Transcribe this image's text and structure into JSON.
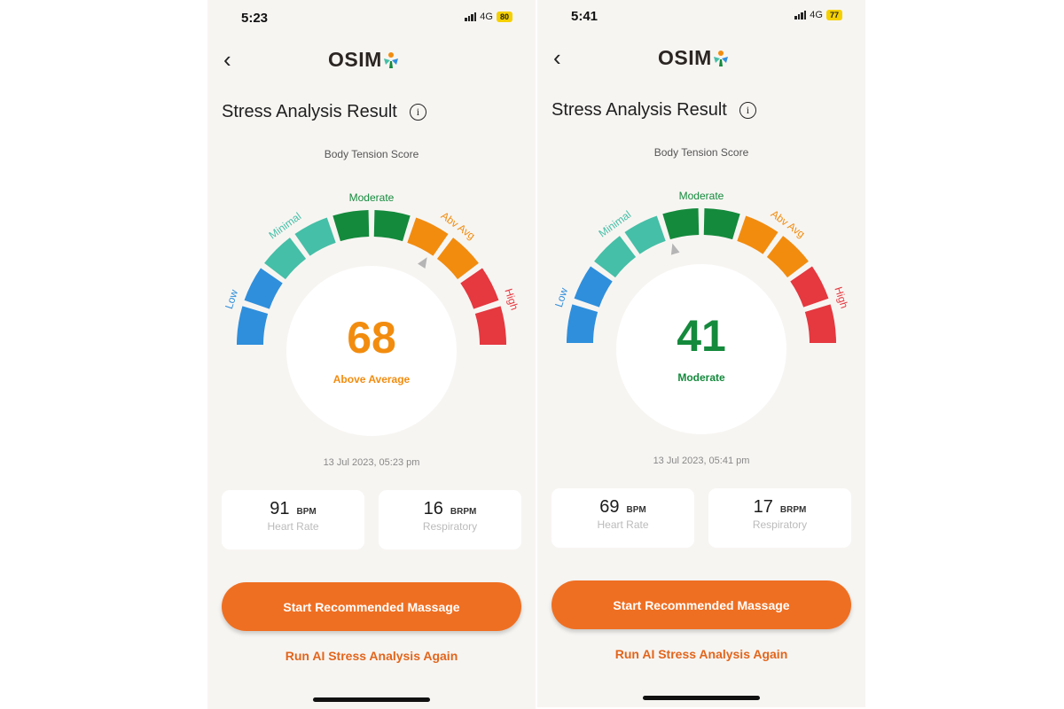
{
  "colors": {
    "low": "#2f8fdc",
    "minimal": "#45bfa7",
    "moderate": "#148a3c",
    "abv_avg": "#f28c0f",
    "high": "#e5383f",
    "button": "#ef6f22",
    "link": "#e2651c"
  },
  "gauge": {
    "range": [
      0,
      100
    ],
    "segments": [
      "low",
      "low",
      "minimal",
      "minimal",
      "moderate",
      "moderate",
      "abv_avg",
      "abv_avg",
      "high",
      "high"
    ],
    "labels": [
      {
        "key": "low",
        "text": "Low"
      },
      {
        "key": "minimal",
        "text": "Minimal"
      },
      {
        "key": "moderate",
        "text": "Moderate"
      },
      {
        "key": "abv_avg",
        "text": "Abv Avg"
      },
      {
        "key": "high",
        "text": "High"
      }
    ]
  },
  "phones": [
    {
      "status": {
        "time": "5:23",
        "network": "4G",
        "battery": "80"
      },
      "logo": "OSIM",
      "title": "Stress Analysis Result",
      "subtitle": "Body Tension Score",
      "score": 68,
      "score_text": "68",
      "level": "Above Average",
      "level_color": "#f28c0f",
      "date": "13 Jul 2023, 05:23 pm",
      "heart": {
        "value": "91",
        "unit": "BPM",
        "label": "Heart Rate"
      },
      "resp": {
        "value": "16",
        "unit": "BRPM",
        "label": "Respiratory"
      },
      "cta": "Start Recommended Massage",
      "again": "Run AI Stress Analysis Again"
    },
    {
      "status": {
        "time": "5:41",
        "network": "4G",
        "battery": "77"
      },
      "logo": "OSIM",
      "title": "Stress Analysis Result",
      "subtitle": "Body Tension Score",
      "score": 41,
      "score_text": "41",
      "level": "Moderate",
      "level_color": "#148a3c",
      "date": "13 Jul 2023, 05:41 pm",
      "heart": {
        "value": "69",
        "unit": "BPM",
        "label": "Heart Rate"
      },
      "resp": {
        "value": "17",
        "unit": "BRPM",
        "label": "Respiratory"
      },
      "cta": "Start Recommended Massage",
      "again": "Run AI Stress Analysis Again"
    }
  ]
}
